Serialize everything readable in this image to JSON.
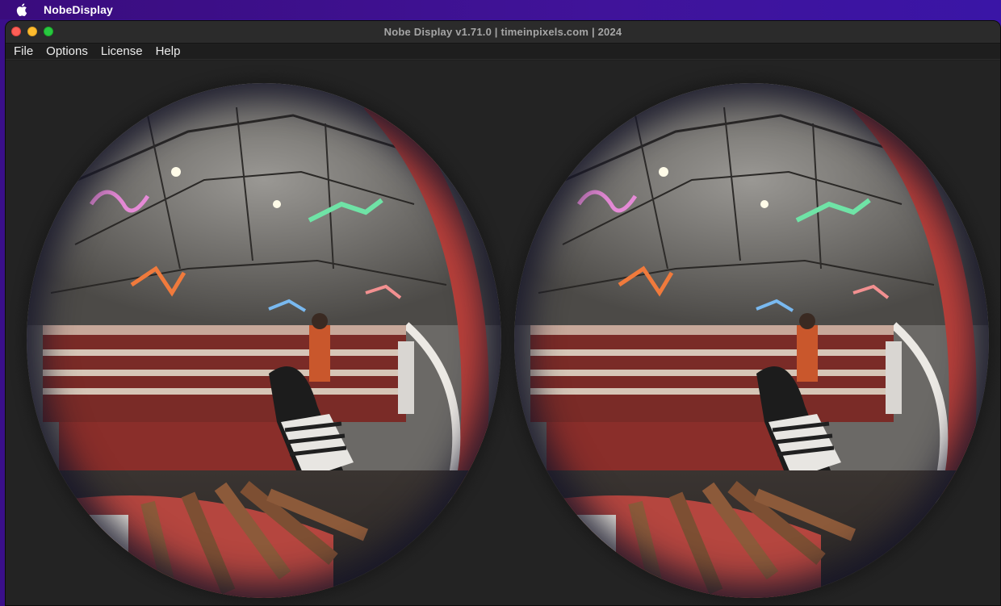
{
  "system_menubar": {
    "app_name": "NobeDisplay",
    "icons": {
      "apple": "apple-logo-icon"
    }
  },
  "window": {
    "title": "Nobe Display v1.71.0 | timeinpixels.com | 2024",
    "menu": [
      {
        "label": "File"
      },
      {
        "label": "Options"
      },
      {
        "label": "License"
      },
      {
        "label": "Help"
      }
    ]
  },
  "viewer": {
    "mode": "stereo fisheye side-by-side",
    "eyes": [
      "left",
      "right"
    ]
  },
  "colors": {
    "menubar_bg": "#3b12a0",
    "window_bg": "#1f1f1f",
    "viewport_bg": "#232323",
    "traffic_red": "#fe5f57",
    "traffic_yellow": "#febc2e",
    "traffic_green": "#28c840"
  }
}
